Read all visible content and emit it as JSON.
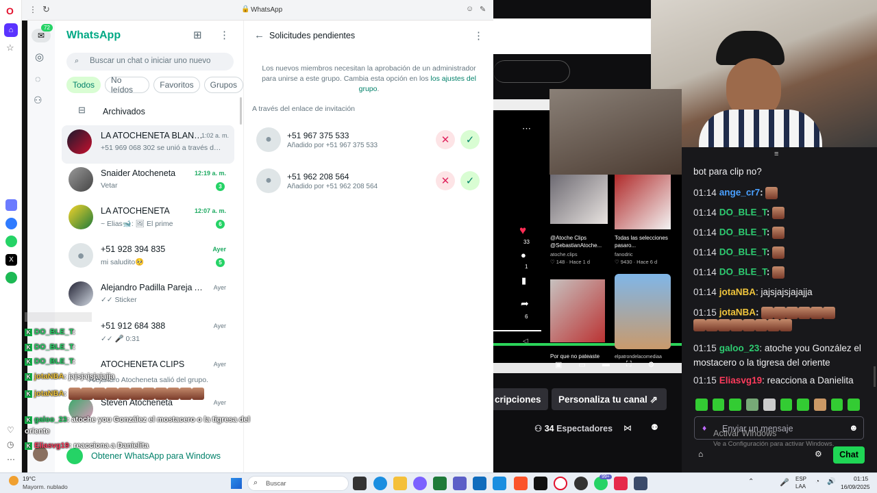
{
  "browser": {
    "tab_title": "WhatsApp"
  },
  "opera": {
    "logo": "O"
  },
  "rail": {
    "badge": "72"
  },
  "chats": {
    "title": "WhatsApp",
    "search_placeholder": "Buscar un chat o iniciar uno nuevo",
    "filters": [
      "Todos",
      "No leídos",
      "Favoritos",
      "Grupos"
    ],
    "archived": "Archivados",
    "items": [
      {
        "name": "LA ATOCHENETA BLANQ...",
        "msg": "+51 969 068 302 se unió a través de ...",
        "time": "1:02 a. m.",
        "badge": ""
      },
      {
        "name": "Snaider Atocheneta",
        "msg": "Vetar",
        "time": "12:19 a. m.",
        "badge": "3"
      },
      {
        "name": "LA ATOCHENETA",
        "msg": "~ Elias🐋: 🖼 El prime",
        "time": "12:07 a. m.",
        "badge": "6"
      },
      {
        "name": "+51 928 394 835",
        "msg": "mi saludito🥺",
        "time": "Ayer",
        "badge": "5"
      },
      {
        "name": "Alejandro Padilla Pareja Atoc...",
        "msg": "✓✓ Sticker",
        "time": "Ayer",
        "badge": ""
      },
      {
        "name": "+51 912 684 388",
        "msg": "✓✓ 🎤 0:31",
        "time": "Ayer",
        "badge": ""
      },
      {
        "name": "ATOCHENETA CLIPS",
        "msg": "Alejandro Atocheneta salió del grupo.",
        "time": "Ayer",
        "badge": ""
      },
      {
        "name": "Steven Atocheneta",
        "msg": "",
        "time": "Ayer",
        "badge": ""
      }
    ],
    "get_windows": "Obtener WhatsApp para Windows"
  },
  "panel": {
    "title": "Solicitudes pendientes",
    "info": "Los nuevos miembros necesitan la aprobación de un administrador para unirse a este grupo. Cambia esta opción en los",
    "info_link": "los ajustes del grupo",
    "section": "A través del enlace de invitación",
    "requests": [
      {
        "number": "+51 967 375 533",
        "added": "Añadido por +51 967 375 533"
      },
      {
        "number": "+51 962 208 564",
        "added": "Añadido por +51 962 208 564"
      }
    ]
  },
  "stream": {
    "video_stats": {
      "likes": "33",
      "comments": "1",
      "shares": "6"
    },
    "clip1": {
      "title": "@Atoche Clips @SebastianAtoche...",
      "sub": "atoche.clips",
      "stats": "♡ 148 · Hace 1 d"
    },
    "clip2": {
      "title": "Todas las selecciones pasaro...",
      "sub": "fanodric",
      "stats": "♡ 9430 · Hace 6 d"
    },
    "clip3_caption": "Por que no pateaste",
    "clip4_caption": "elpatrondelacomediaa",
    "subs_button": "cripciones",
    "customize_button": "Personaliza tu canal",
    "viewers": "34",
    "viewers_label": "Espectadores",
    "chat_lines": [
      {
        "time": "",
        "user": "",
        "text": "bot para clip no?"
      },
      {
        "time": "01:14",
        "user": "ange_cr7",
        "text": ":"
      },
      {
        "time": "01:14",
        "user": "DO_BLE_T",
        "text": ":"
      },
      {
        "time": "01:14",
        "user": "DO_BLE_T",
        "text": ":"
      },
      {
        "time": "01:14",
        "user": "DO_BLE_T",
        "text": ":"
      },
      {
        "time": "01:14",
        "user": "DO_BLE_T",
        "text": ":"
      },
      {
        "time": "01:14",
        "user": "jotaNBA",
        "text": ": jajsjajsjajajja"
      },
      {
        "time": "01:15",
        "user": "jotaNBA",
        "text": ":"
      },
      {
        "time": "01:15",
        "user": "galoo_23",
        "text": ": atoche you González el mostacero o la tigresa del oriente"
      },
      {
        "time": "01:15",
        "user": "Eliasvg19",
        "text": ": reacciona a Danielita"
      }
    ],
    "message_placeholder": "Enviar un mensaje",
    "chat_button": "Chat",
    "activate_title": "Activar Windows",
    "activate_sub": "Ve a Configuración para activar Windows."
  },
  "overlay": [
    {
      "user": "DO_BLE_T",
      "text": ":"
    },
    {
      "user": "DO_BLE_T",
      "text": ":"
    },
    {
      "user": "DO_BLE_T",
      "text": ":"
    },
    {
      "user": "jotaNBA",
      "text": ": jajsjajsjajajja"
    },
    {
      "user": "jotaNBA",
      "text": ":"
    },
    {
      "user": "galoo_23",
      "text": ": atoche you González el mostacero o la tigresa del oriente"
    },
    {
      "user": "Eliasvg19",
      "text": ": reacciona a Danielita"
    }
  ],
  "taskbar": {
    "temp": "19°C",
    "weather": "Mayorm. nublado",
    "search": "Buscar",
    "lang1": "ESP",
    "lang2": "LAA",
    "time": "01:15",
    "date": "16/09/2025",
    "badge": "99+"
  },
  "colors": {
    "wa_green": "#008069",
    "twitch_purple": "#9147ff",
    "chat_green": "#00ff7f",
    "user_green": "#2ecc71",
    "user_red": "#ff3b5c",
    "user_blue": "#4aa0ff",
    "user_yellow": "#f0c53c"
  }
}
